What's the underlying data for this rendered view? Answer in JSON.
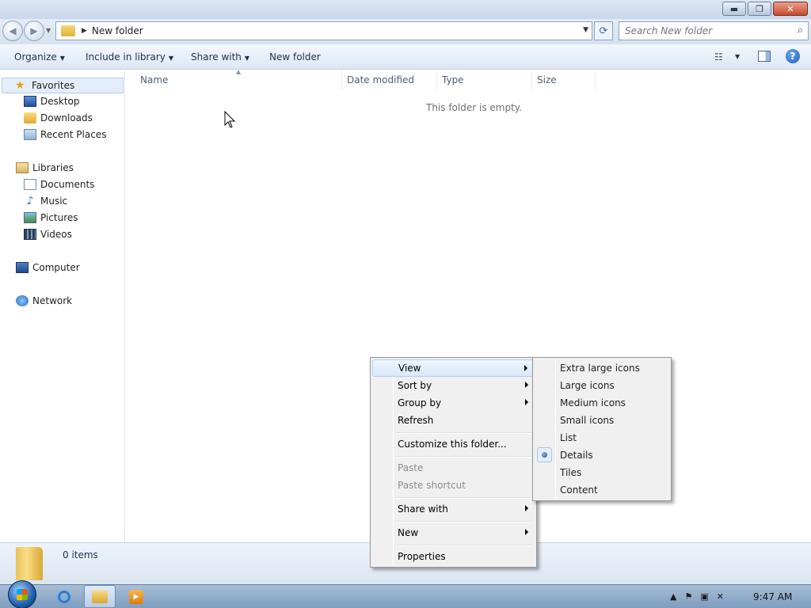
{
  "window": {
    "buttons": {
      "minimize": "▬",
      "maximize": "❐",
      "close": "✕"
    }
  },
  "navigation": {
    "back_icon": "back-arrow-icon",
    "forward_icon": "forward-arrow-icon",
    "address_path": "New folder",
    "search_placeholder": "Search New folder"
  },
  "toolbar": {
    "organize": "Organize",
    "include_in_library": "Include in library",
    "share_with": "Share with",
    "new_folder": "New folder"
  },
  "sidebar": {
    "favorites": "Favorites",
    "favorites_items": [
      "Desktop",
      "Downloads",
      "Recent Places"
    ],
    "libraries": "Libraries",
    "libraries_items": [
      "Documents",
      "Music",
      "Pictures",
      "Videos"
    ],
    "computer": "Computer",
    "network": "Network"
  },
  "columns": [
    "Name",
    "Date modified",
    "Type",
    "Size"
  ],
  "content": {
    "empty_message": "This folder is empty."
  },
  "status": {
    "item_count": "0 items"
  },
  "context_menu": {
    "items": [
      {
        "label": "View",
        "submenu": true,
        "highlighted": true
      },
      {
        "label": "Sort by",
        "submenu": true
      },
      {
        "label": "Group by",
        "submenu": true
      },
      {
        "label": "Refresh"
      },
      {
        "label": "Customize this folder..."
      },
      {
        "label": "Paste",
        "disabled": true
      },
      {
        "label": "Paste shortcut",
        "disabled": true
      },
      {
        "label": "Share with",
        "submenu": true
      },
      {
        "label": "New",
        "submenu": true
      },
      {
        "label": "Properties"
      }
    ],
    "view_submenu": [
      "Extra large icons",
      "Large icons",
      "Medium icons",
      "Small icons",
      "List",
      "Details",
      "Tiles",
      "Content"
    ],
    "selected_view": "Details"
  },
  "taskbar": {
    "clock": "9:47 AM"
  }
}
